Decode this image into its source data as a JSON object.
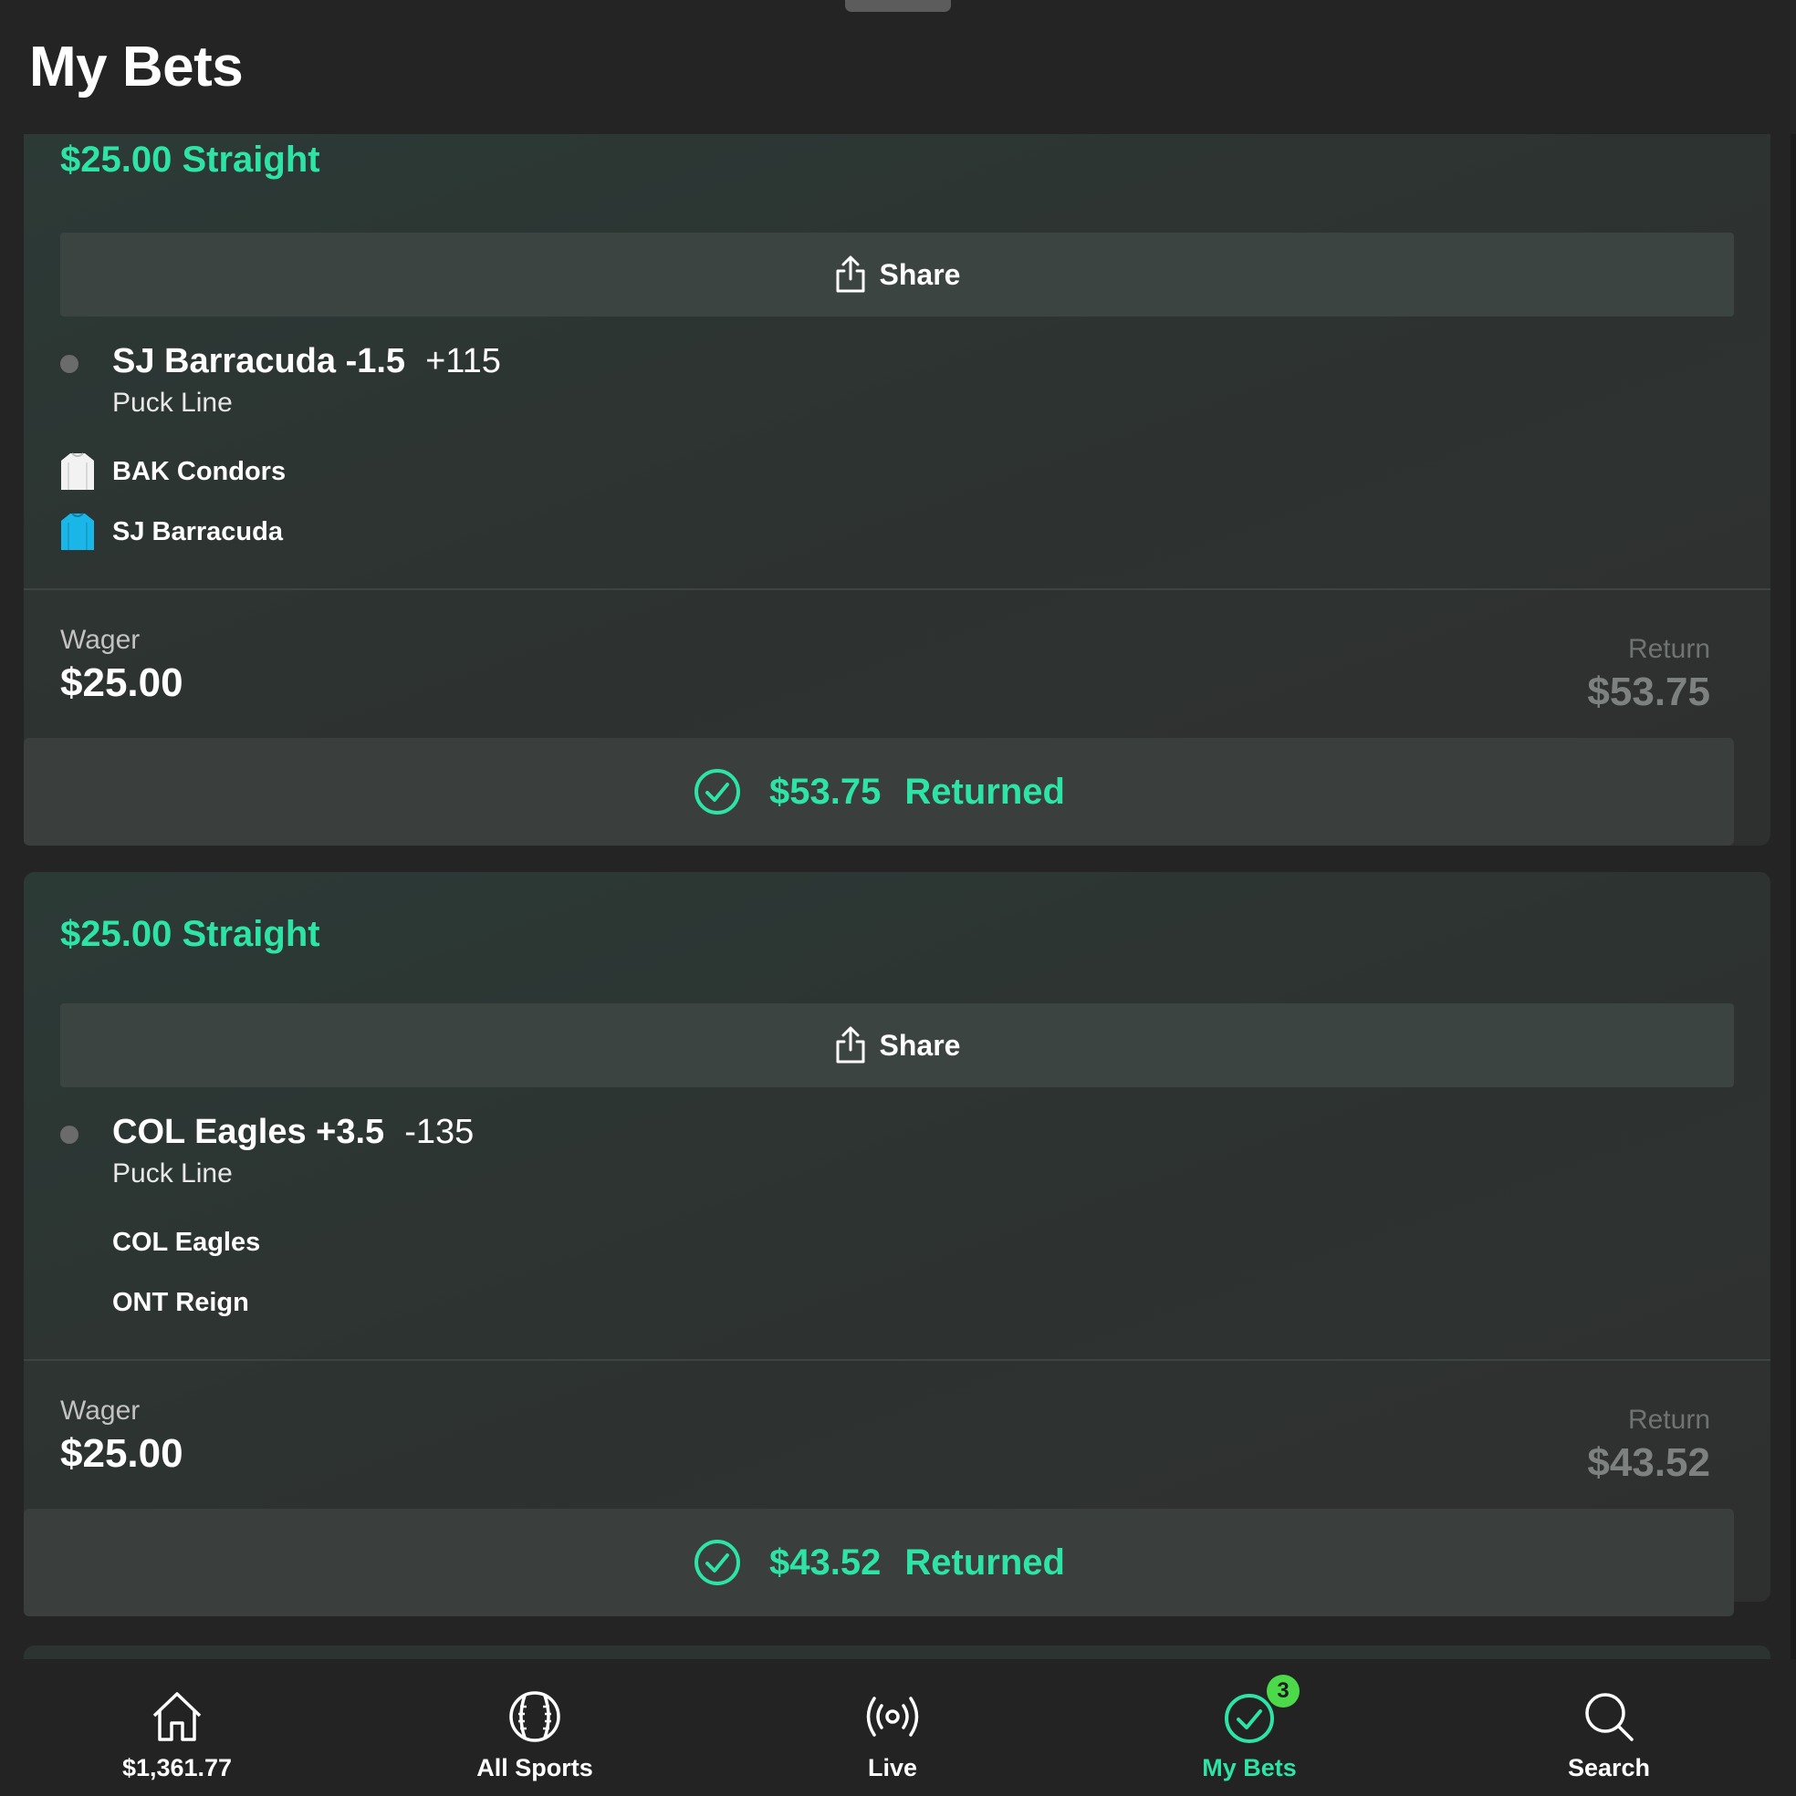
{
  "page": {
    "title": "My Bets"
  },
  "bets": [
    {
      "title": "$25.00 Straight",
      "share_label": "Share",
      "selection": {
        "name": "SJ Barracuda -1.5",
        "odds": "+115",
        "market": "Puck Line"
      },
      "teams": [
        {
          "name": "BAK Condors",
          "jersey_color": "#f2f2f2"
        },
        {
          "name": "SJ Barracuda",
          "jersey_color": "#1ab6e8"
        }
      ],
      "wager_label": "Wager",
      "wager_value": "$25.00",
      "return_label": "Return",
      "return_value": "$53.75",
      "returned_amount": "$53.75",
      "returned_label": "Returned"
    },
    {
      "title": "$25.00 Straight",
      "share_label": "Share",
      "selection": {
        "name": "COL Eagles +3.5",
        "odds": "-135",
        "market": "Puck Line"
      },
      "teams": [
        {
          "name": "COL Eagles"
        },
        {
          "name": "ONT Reign"
        }
      ],
      "wager_label": "Wager",
      "wager_value": "$25.00",
      "return_label": "Return",
      "return_value": "$43.52",
      "returned_amount": "$43.52",
      "returned_label": "Returned"
    }
  ],
  "nav": {
    "items": [
      {
        "label": "$1,361.77",
        "icon": "home-icon"
      },
      {
        "label": "All Sports",
        "icon": "baseball-icon"
      },
      {
        "label": "Live",
        "icon": "live-broadcast-icon"
      },
      {
        "label": "My Bets",
        "icon": "check-circle-icon",
        "badge": "3",
        "active": true
      },
      {
        "label": "Search",
        "icon": "search-icon"
      }
    ]
  },
  "colors": {
    "accent": "#2de3a5",
    "background": "#242424",
    "badge": "#4cd94a"
  }
}
